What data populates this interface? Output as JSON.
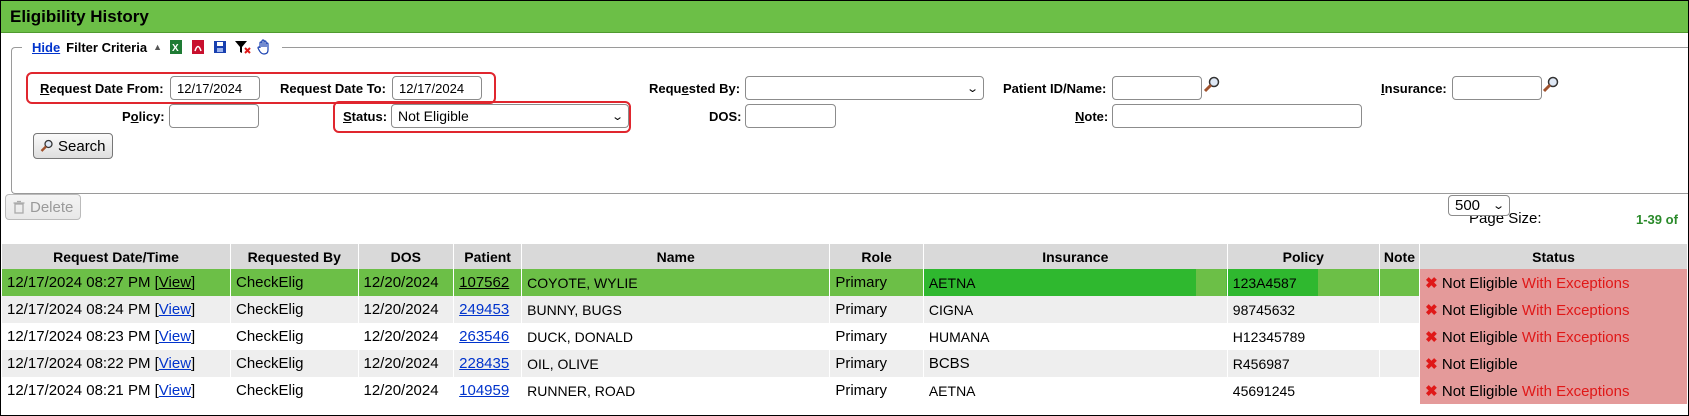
{
  "title": "Eligibility History",
  "filter": {
    "hide_link": "Hide",
    "label": "Filter Criteria"
  },
  "fields": {
    "request_date_from": {
      "label_pre": "R",
      "label_rest": "equest Date From:",
      "value": "12/17/2024"
    },
    "request_date_to": {
      "label": "Request Date To:",
      "value": "12/17/2024"
    },
    "requested_by": {
      "label_pre": "Requ",
      "label_u": "e",
      "label_rest": "sted By:",
      "value": ""
    },
    "patient": {
      "label": "Patient ID/Name:",
      "value": ""
    },
    "insurance": {
      "label_u": "I",
      "label_rest": "nsurance:",
      "value": ""
    },
    "policy": {
      "label_pre": "P",
      "label_u": "o",
      "label_rest": "licy:",
      "value": ""
    },
    "status": {
      "label_u": "S",
      "label_rest": "tatus:",
      "value": "Not Eligible"
    },
    "dos": {
      "label": "DOS:",
      "value": ""
    },
    "note": {
      "label_u": "N",
      "label_rest": "ote:",
      "value": ""
    }
  },
  "buttons": {
    "search": "Search",
    "delete": "Delete"
  },
  "page_size": {
    "label": "Page Size:",
    "value": "500",
    "range": "1-39 of"
  },
  "table": {
    "headers": [
      "Request Date/Time",
      "Requested By",
      "DOS",
      "Patient",
      "Name",
      "Role",
      "Insurance",
      "Policy",
      "Note",
      "Status"
    ],
    "view_label": "View",
    "rows": [
      {
        "datetime": "12/17/2024 08:27 PM",
        "requested_by": "CheckElig",
        "dos": "12/20/2024",
        "patient": "107562",
        "name": "COYOTE, WYLIE",
        "role": "Primary",
        "insurance": "AETNA",
        "policy": "123A4587",
        "note": "",
        "status": "Not Eligible",
        "exceptions": "With Exceptions"
      },
      {
        "datetime": "12/17/2024 08:24 PM",
        "requested_by": "CheckElig",
        "dos": "12/20/2024",
        "patient": "249453",
        "name": "BUNNY, BUGS",
        "role": "Primary",
        "insurance": "CIGNA",
        "policy": "98745632",
        "note": "",
        "status": "Not Eligible",
        "exceptions": "With Exceptions"
      },
      {
        "datetime": "12/17/2024 08:23 PM",
        "requested_by": "CheckElig",
        "dos": "12/20/2024",
        "patient": "263546",
        "name": "DUCK, DONALD",
        "role": "Primary",
        "insurance": "HUMANA",
        "policy": "H12345789",
        "note": "",
        "status": "Not Eligible",
        "exceptions": "With Exceptions"
      },
      {
        "datetime": "12/17/2024 08:22 PM",
        "requested_by": "CheckElig",
        "dos": "12/20/2024",
        "patient": "228435",
        "name": "OIL, OLIVE",
        "role": "Primary",
        "insurance": "BCBS",
        "policy": "R456987",
        "note": "",
        "status": "Not Eligible",
        "exceptions": ""
      },
      {
        "datetime": "12/17/2024 08:21 PM",
        "requested_by": "CheckElig",
        "dos": "12/20/2024",
        "patient": "104959",
        "name": "RUNNER, ROAD",
        "role": "Primary",
        "insurance": "AETNA",
        "policy": "45691245",
        "note": "",
        "status": "Not Eligible",
        "exceptions": "With Exceptions"
      }
    ]
  },
  "colors": {
    "title_bar": "#6cbf47",
    "selected_row": "#6cbf47",
    "status_cell": "#e49a9a",
    "exception_text": "#e01818",
    "highlight_box": "#e0262e"
  },
  "icons": [
    "excel-icon",
    "pdf-icon",
    "save-icon",
    "clear-filter-icon",
    "hand-icon",
    "magnifier-icon",
    "trash-icon"
  ]
}
